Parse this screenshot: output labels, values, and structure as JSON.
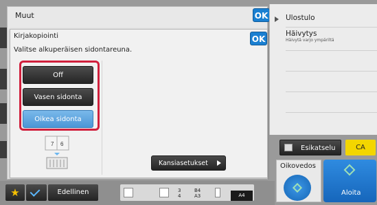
{
  "main": {
    "title": "Muut",
    "ok_label": "OK"
  },
  "right_panel": {
    "items": [
      {
        "label": "Ulostulo",
        "sub": ""
      },
      {
        "label": "Häivytys",
        "sub": "Häivytä varjo ympäriltä"
      }
    ]
  },
  "dialog": {
    "title": "Kirjakopiointi",
    "instruction": "Valitse alkuperäisen sidontareuna.",
    "ok_label": "OK",
    "options": [
      {
        "label": "Off",
        "selected": false
      },
      {
        "label": "Vasen sidonta",
        "selected": false
      },
      {
        "label": "Oikea sidonta",
        "selected": true
      }
    ],
    "diagram_pages": [
      "7",
      "6"
    ],
    "cover_settings_label": "Kansiasetukset"
  },
  "actions": {
    "preview_label": "Esikatselu",
    "ca_label": "CA",
    "proof_label": "Oikovedos",
    "start_label": "Aloita"
  },
  "toolbar": {
    "previous_label": "Edellinen",
    "trays": [
      {
        "number": "3",
        "size": "B4"
      },
      {
        "number": "4",
        "size": "A3"
      }
    ],
    "paper_size": "A4"
  },
  "colors": {
    "accent_blue": "#1a7fd1",
    "selected_option": "#5aa3e0",
    "highlight_border": "#d01f3c",
    "ca_yellow": "#f3d600"
  }
}
